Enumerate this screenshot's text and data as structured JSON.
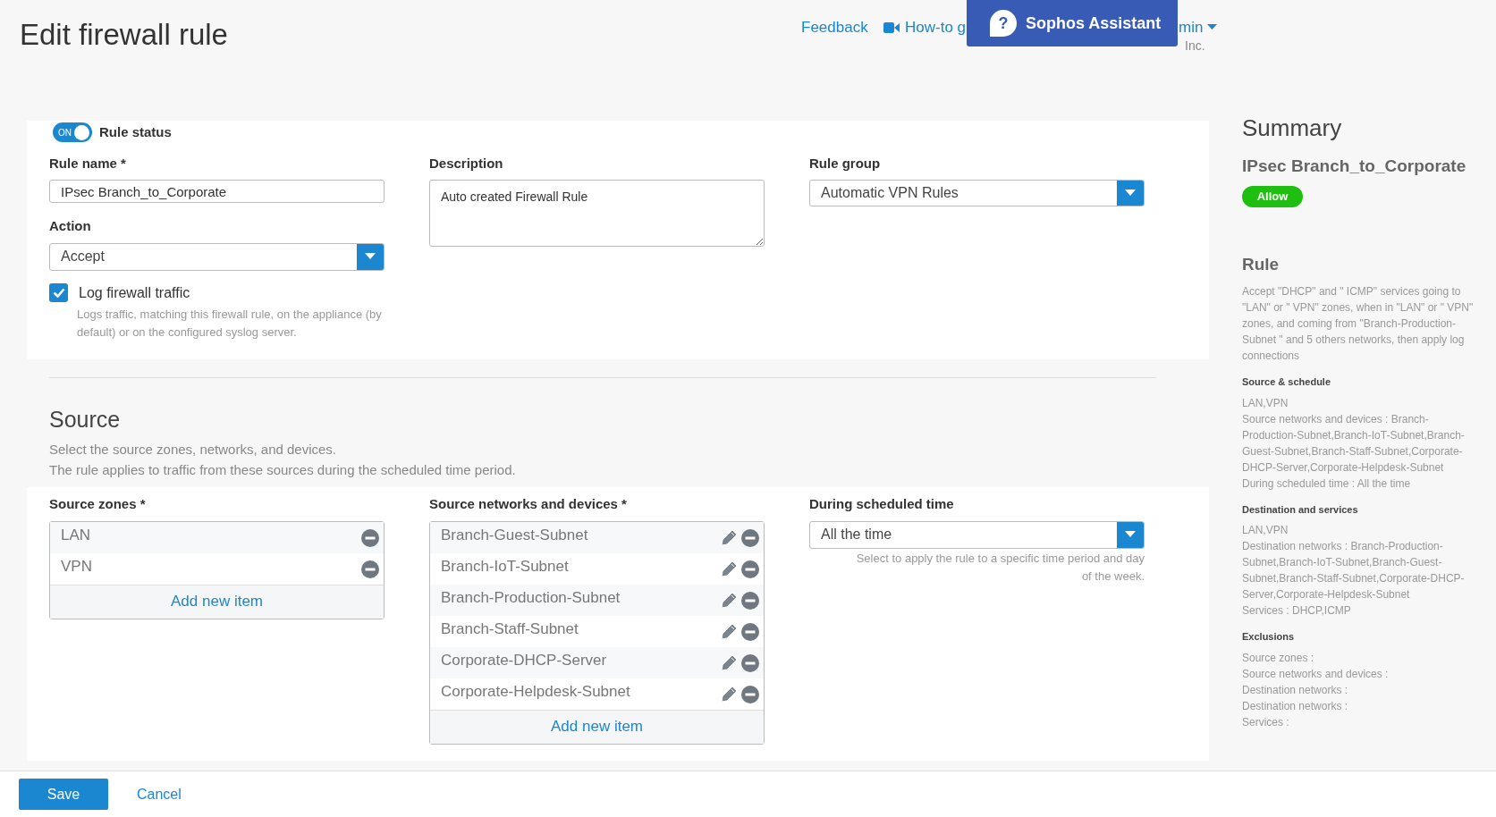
{
  "page_title": "Edit firewall rule",
  "header": {
    "feedback": "Feedback",
    "howto": "How-to g",
    "admin": "min",
    "company": "Inc.",
    "assistant_icon": "?",
    "assistant": "Sophos Assistant"
  },
  "rule_status": {
    "toggle_text": "ON",
    "on": true,
    "label": "Rule status"
  },
  "rule_name": {
    "label": "Rule name *",
    "value": "IPsec Branch_to_Corporate"
  },
  "description": {
    "label": "Description",
    "value": "Auto created Firewall Rule"
  },
  "rule_group": {
    "label": "Rule group",
    "value": "Automatic VPN Rules"
  },
  "action": {
    "label": "Action",
    "value": "Accept"
  },
  "log_traffic": {
    "label": "Log firewall traffic",
    "checked": true,
    "help": "Logs traffic, matching this firewall rule, on the appliance (by default) or on the configured syslog server."
  },
  "source": {
    "heading": "Source",
    "lines": [
      "Select the source zones, networks, and devices.",
      "The rule applies to traffic from these sources during the scheduled time period."
    ],
    "zones": {
      "label": "Source zones *",
      "items": [
        "LAN",
        "VPN"
      ],
      "add": "Add new item"
    },
    "networks": {
      "label": "Source networks and devices *",
      "items": [
        "Branch-Guest-Subnet",
        "Branch-IoT-Subnet",
        "Branch-Production-Subnet",
        "Branch-Staff-Subnet",
        "Corporate-DHCP-Server",
        "Corporate-Helpdesk-Subnet"
      ],
      "add": "Add new item"
    },
    "schedule": {
      "label": "During scheduled time",
      "value": "All the time",
      "help": "Select to apply the rule to a specific time period and day of the week."
    }
  },
  "summary": {
    "title": "Summary",
    "rule_name": "IPsec Branch_to_Corporate",
    "badge": "Allow",
    "rule_heading": "Rule",
    "rule_text": "Accept \"DHCP\" and \" ICMP\" services going to \"LAN\" or \" VPN\" zones, when in \"LAN\" or \" VPN\" zones, and coming from \"Branch-Production-Subnet \" and 5 others networks, then apply log connections",
    "sections": [
      {
        "heading": "Source & schedule",
        "lines": [
          "LAN,VPN",
          "Source networks and devices : Branch-Production-Subnet,Branch-IoT-Subnet,Branch-Guest-Subnet,Branch-Staff-Subnet,Corporate-DHCP-Server,Corporate-Helpdesk-Subnet",
          "During scheduled time : All the time"
        ]
      },
      {
        "heading": "Destination and services",
        "lines": [
          "LAN,VPN",
          "Destination networks : Branch-Production-Subnet,Branch-IoT-Subnet,Branch-Guest-Subnet,Branch-Staff-Subnet,Corporate-DHCP-Server,Corporate-Helpdesk-Subnet",
          "Services : DHCP,ICMP"
        ]
      },
      {
        "heading": "Exclusions",
        "lines": [
          "Source zones :",
          "Source networks and devices :",
          "Destination networks :",
          "Destination networks :",
          "Services :"
        ]
      }
    ]
  },
  "footer": {
    "save": "Save",
    "cancel": "Cancel"
  }
}
